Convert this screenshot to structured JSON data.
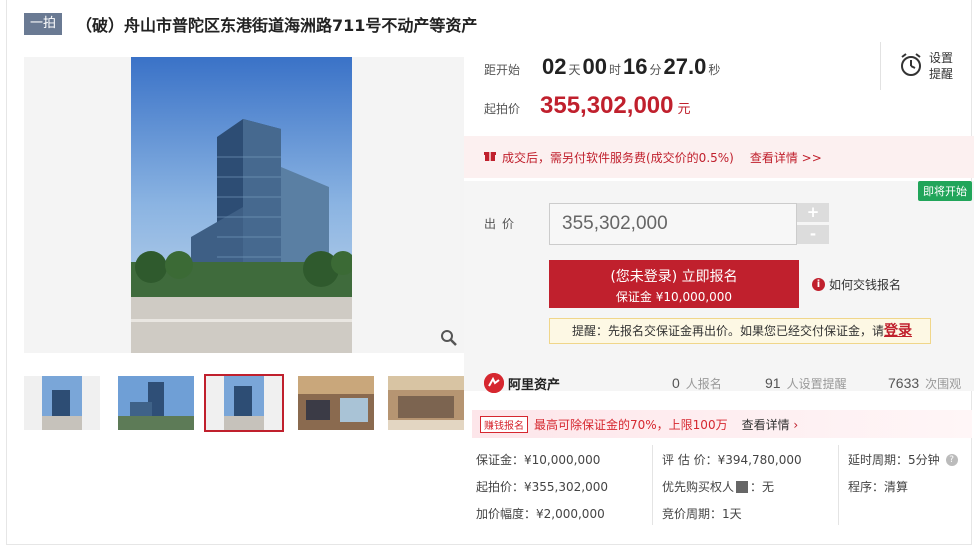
{
  "header": {
    "badge": "一拍",
    "title": "（破）舟山市普陀区东港街道海洲路711号不动产等资产"
  },
  "countdown": {
    "label": "距开始",
    "days": "02",
    "days_unit": "天",
    "hours": "00",
    "hours_unit": "时",
    "minutes": "16",
    "minutes_unit": "分",
    "seconds": "27.0",
    "seconds_unit": "秒"
  },
  "reminder": {
    "label": "设置提醒",
    "icon": "alarm-clock-icon"
  },
  "start_price": {
    "label": "起拍价",
    "value": "355,302,000",
    "unit": "元"
  },
  "fee_notice": {
    "icon": "gift-icon",
    "text": "成交后，需另付软件服务费(成交价的0.5%)",
    "link": "查看详情 >>"
  },
  "bid": {
    "status_tag": "即将开始",
    "label": "出价",
    "input_value": "355,302,000",
    "plus": "+",
    "minus": "-",
    "register_line1": "(您未登录) 立即报名",
    "register_line2": "保证金 ¥10,000,000",
    "how_to": "如何交钱报名",
    "tip_text": "提醒：先报名交保证金再出价。如果您已经交付保证金，请",
    "tip_login": "登录"
  },
  "platform": {
    "name": "阿里资产",
    "registered_count": "0",
    "registered_label": "人报名",
    "reminder_count": "91",
    "reminder_label": "人设置提醒",
    "views_count": "7633",
    "views_label": "次围观"
  },
  "loan": {
    "tag": "赚钱报名",
    "text": "最高可除保证金的70%，上限100万",
    "link": "查看详情"
  },
  "details": {
    "deposit": "保证金：¥10,000,000",
    "start_price": "起拍价：¥355,302,000",
    "increment": "加价幅度：¥2,000,000",
    "appraisal": "评 估 价：¥394,780,000",
    "priority_label": "优先购买权人",
    "priority_value": "：无",
    "bid_period": "竞价周期：1天",
    "delay": "延时周期：5分钟",
    "procedure": "程序：清算"
  },
  "colors": {
    "accent": "#c0202d",
    "badge": "#6a7a93",
    "soon": "#21a55a"
  }
}
